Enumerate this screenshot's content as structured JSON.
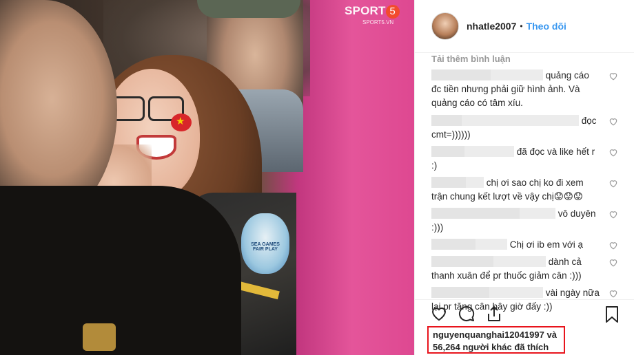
{
  "photo": {
    "watermark_brand": "SPORT",
    "watermark_digit": "5",
    "watermark_site": "SPORT5.VN",
    "patch_text": "SEA GAMES FAIR PLAY"
  },
  "header": {
    "username": "nhatle2007",
    "separator": "•",
    "follow_label": "Theo dõi"
  },
  "comments": {
    "load_more": "Tải thêm bình luận",
    "items": [
      {
        "line1": "quảng cáo",
        "line2": "đc tiền nhưng phải giữ hình ảnh. Và",
        "line3": "quảng cáo có tâm xíu."
      },
      {
        "line1": "đọc",
        "line2": "cmt=))))))"
      },
      {
        "line1": "đã đọc và like hết r",
        "line2": ":)"
      },
      {
        "line1": "chị ơi sao chị ko đi xem",
        "line2": "trận chung kết lượt về vậy chị😟😟😟"
      },
      {
        "line1": "vô duyên",
        "line2": ":)))"
      },
      {
        "line1": "Chị ơi ib em với ạ"
      },
      {
        "line1": "dành cả",
        "line2": "thanh xuân để pr thuốc giảm cân :)))"
      },
      {
        "line1": "vài ngày nữa",
        "line2": "lại pr tăng cân bây giờ đấy :))"
      }
    ]
  },
  "actions": {
    "like_icon": "heart-outline-icon",
    "comment_icon": "comment-bubble-icon",
    "share_icon": "share-upload-icon",
    "save_icon": "bookmark-icon"
  },
  "likes": {
    "first_liker": "nguyenquanghai12041997",
    "conjunction": "và",
    "others": "56,264 người khác đã thích"
  },
  "colors": {
    "accent": "#3897f0",
    "highlight_border": "#e8141c",
    "photo_pink": "#de4891"
  }
}
